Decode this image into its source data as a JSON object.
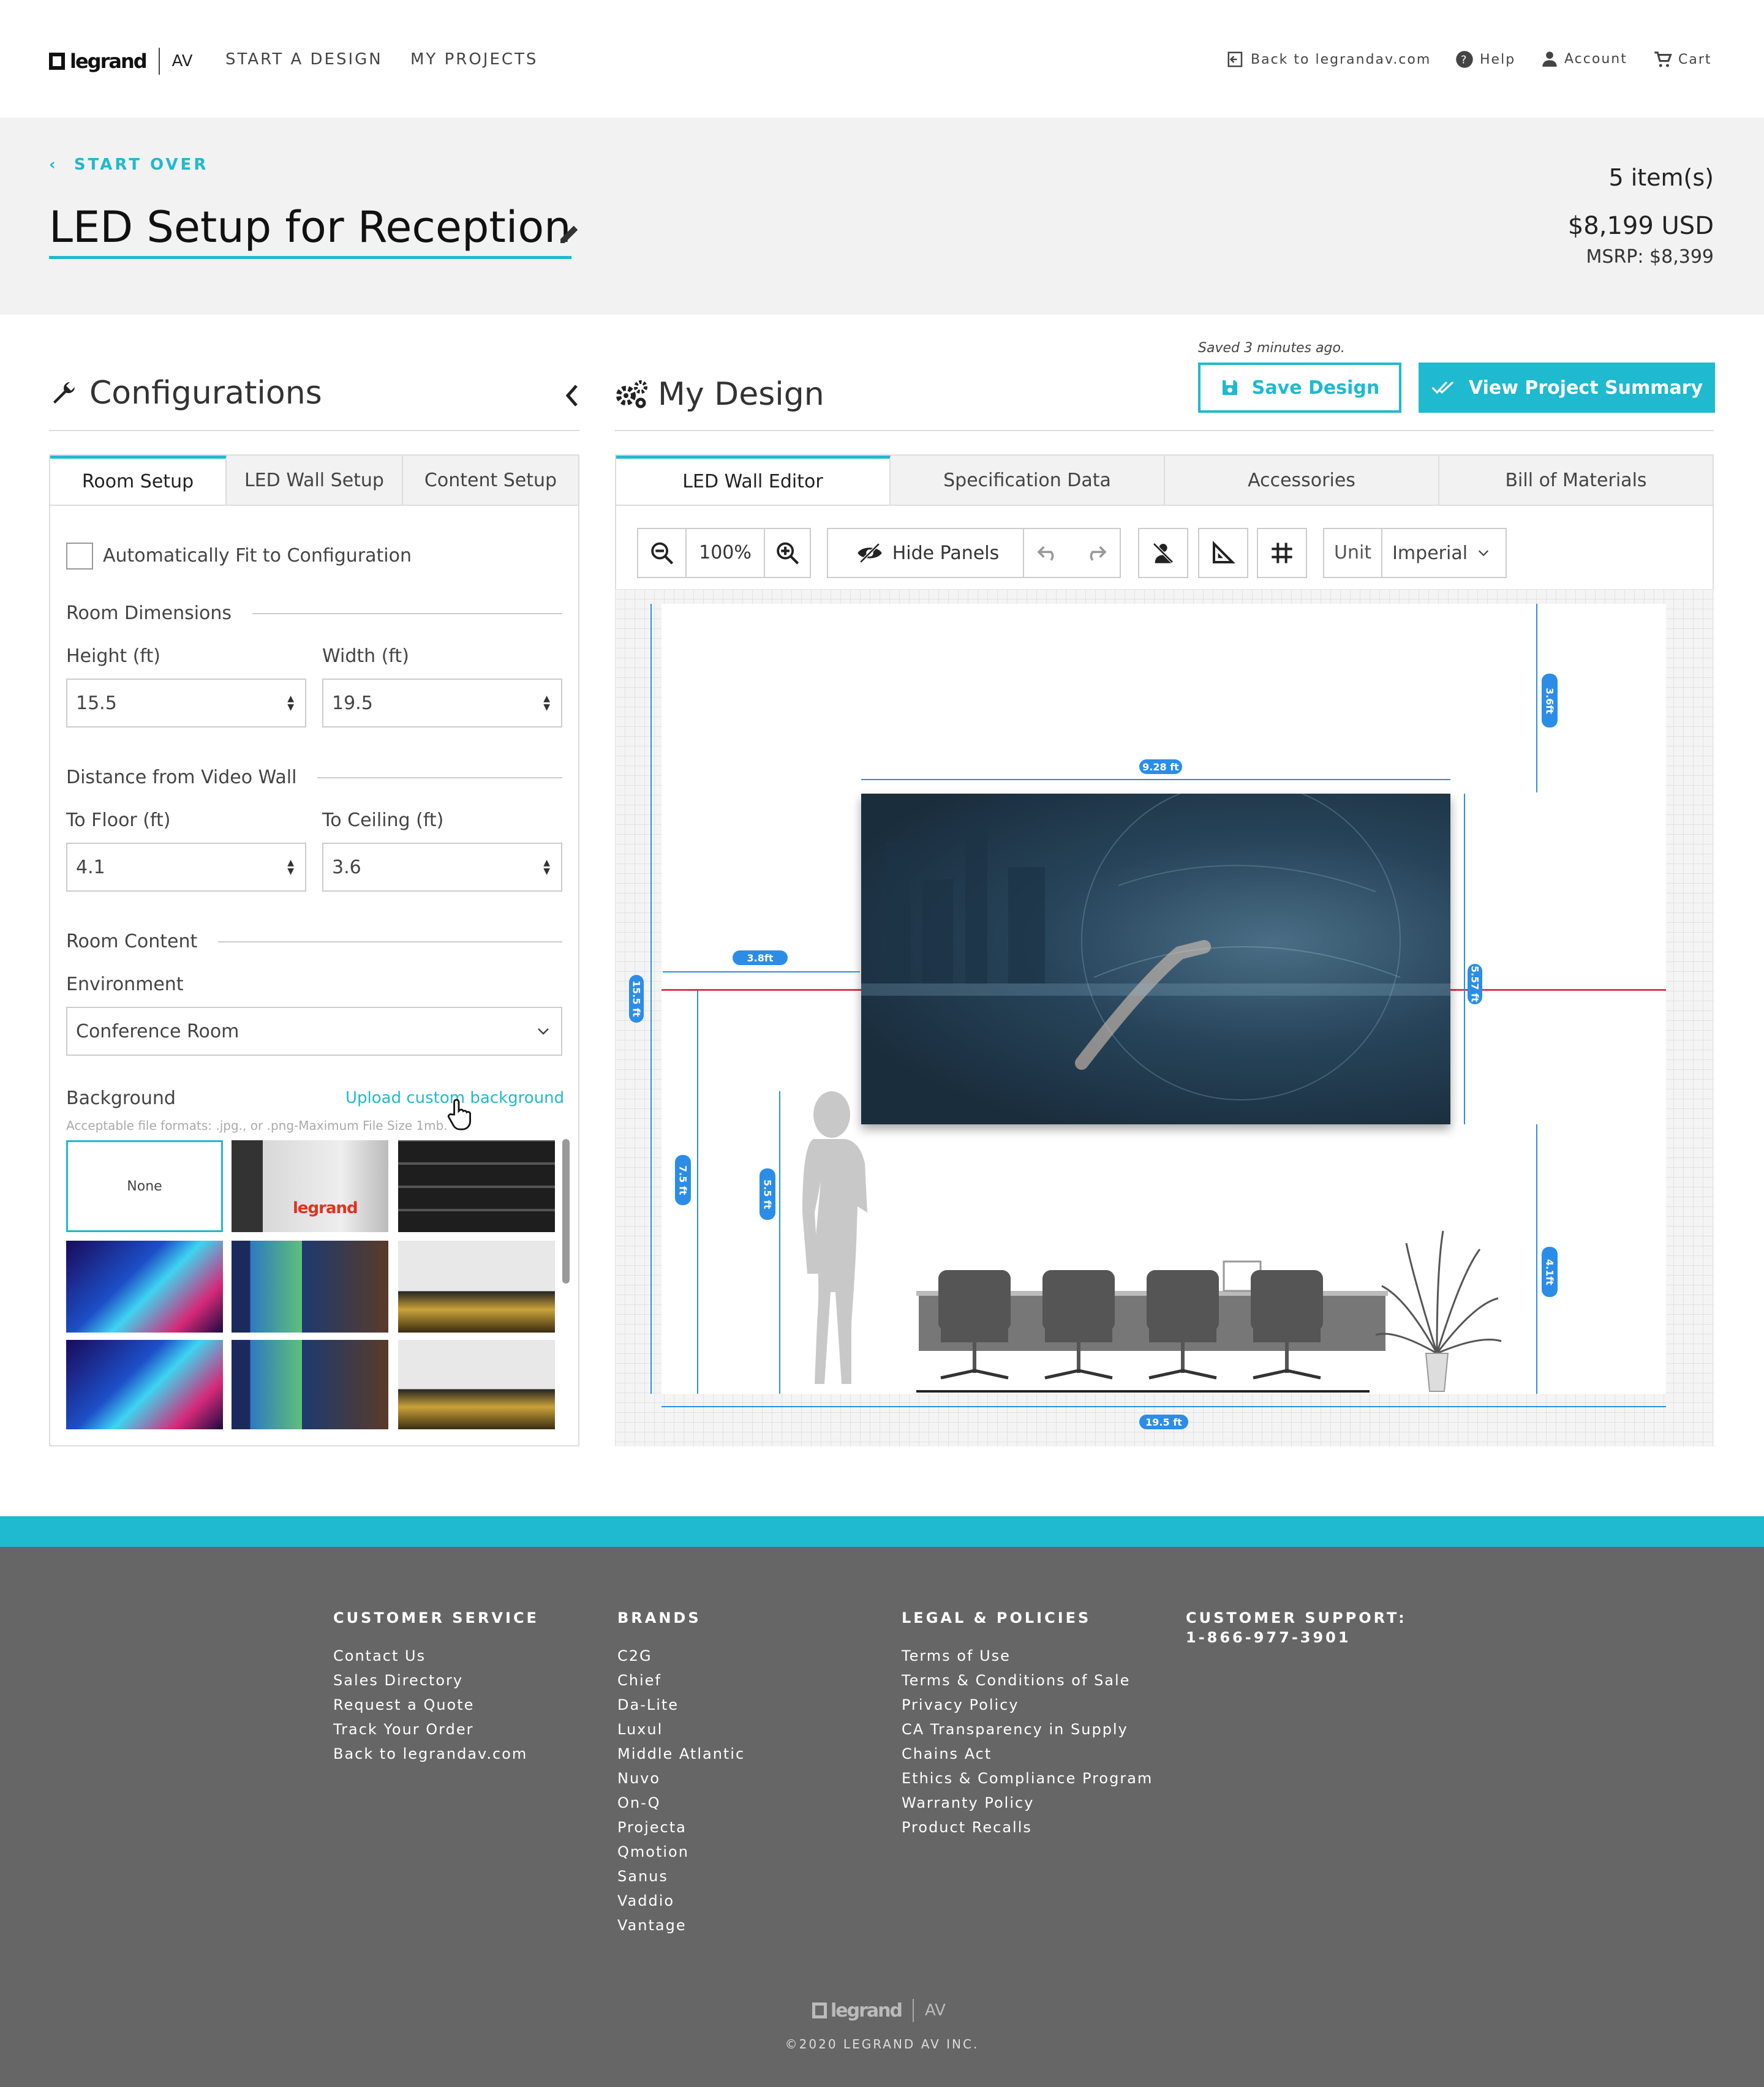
{
  "nav": {
    "brand": "legrand",
    "brand_suffix": "AV",
    "links": [
      "START A DESIGN",
      "MY PROJECTS"
    ],
    "back_link": "Back to legrandav.com",
    "help": "Help",
    "account": "Account",
    "cart": "Cart"
  },
  "header": {
    "start_over": "START OVER",
    "title": "LED Setup for Reception",
    "items": "5 item(s)",
    "price": "$8,199 USD",
    "msrp": "MSRP: $8,399"
  },
  "config": {
    "title": "Configurations",
    "tabs": [
      "Room Setup",
      "LED Wall Setup",
      "Content Setup"
    ],
    "auto_fit": "Automatically Fit to Configuration",
    "room_dimensions": "Room Dimensions",
    "height_label": "Height (ft)",
    "height_value": "15.5",
    "width_label": "Width (ft)",
    "width_value": "19.5",
    "distance": "Distance from Video Wall",
    "floor_label": "To Floor (ft)",
    "floor_value": "4.1",
    "ceiling_label": "To Ceiling (ft)",
    "ceiling_value": "3.6",
    "room_content": "Room Content",
    "environment_label": "Environment",
    "environment_value": "Conference Room",
    "background_label": "Background",
    "upload_link": "Upload custom background",
    "file_note": "Acceptable file formats: .jpg., or .png-Maximum File Size 1mb.",
    "none_label": "None",
    "thumb_logo": "legrand"
  },
  "design": {
    "title": "My Design",
    "saved": "Saved 3 minutes ago.",
    "save_button": "Save Design",
    "view_button": "View Project Summary",
    "tabs": [
      "LED Wall Editor",
      "Specification Data",
      "Accessories",
      "Bill of Materials"
    ],
    "zoom": "100%",
    "hide_panels": "Hide Panels",
    "unit_label": "Unit",
    "unit_value": "Imperial",
    "dims": {
      "wall_width": "9.28 ft",
      "ceiling": "3.6ft",
      "side": "3.8ft",
      "room_height": "15.5 ft",
      "wall_height": "5.57 ft",
      "center": "7.5 ft",
      "person": "5.5 ft",
      "floor": "4.1ft",
      "room_width": "19.5 ft"
    }
  },
  "footer": {
    "cols": [
      {
        "title": "CUSTOMER SERVICE",
        "items": [
          "Contact Us",
          "Sales Directory",
          "Request a Quote",
          "Track Your Order",
          "Back to legrandav.com"
        ]
      },
      {
        "title": "BRANDS",
        "items": [
          "C2G",
          "Chief",
          "Da-Lite",
          "Luxul",
          "Middle Atlantic",
          "Nuvo",
          "On-Q",
          "Projecta",
          "Qmotion",
          "Sanus",
          "Vaddio",
          "Vantage"
        ]
      },
      {
        "title": "LEGAL & POLICIES",
        "items": [
          "Terms of Use",
          "Terms & Conditions of Sale",
          "Privacy Policy",
          "CA Transparency in Supply",
          "Chains Act",
          "Ethics & Compliance Program",
          "Warranty Policy",
          "Product Recalls"
        ]
      }
    ],
    "support_title": "CUSTOMER SUPPORT:",
    "support_phone": "1-866-977-3901",
    "brand": "legrand",
    "brand_suffix": "AV",
    "copyright": "©2020 LEGRAND AV INC."
  },
  "colors": {
    "accent": "#1fb9d0",
    "dimension": "#2b8de8",
    "footer": "#666666",
    "band": "#f2f2f2",
    "center_line": "#d9394e"
  }
}
